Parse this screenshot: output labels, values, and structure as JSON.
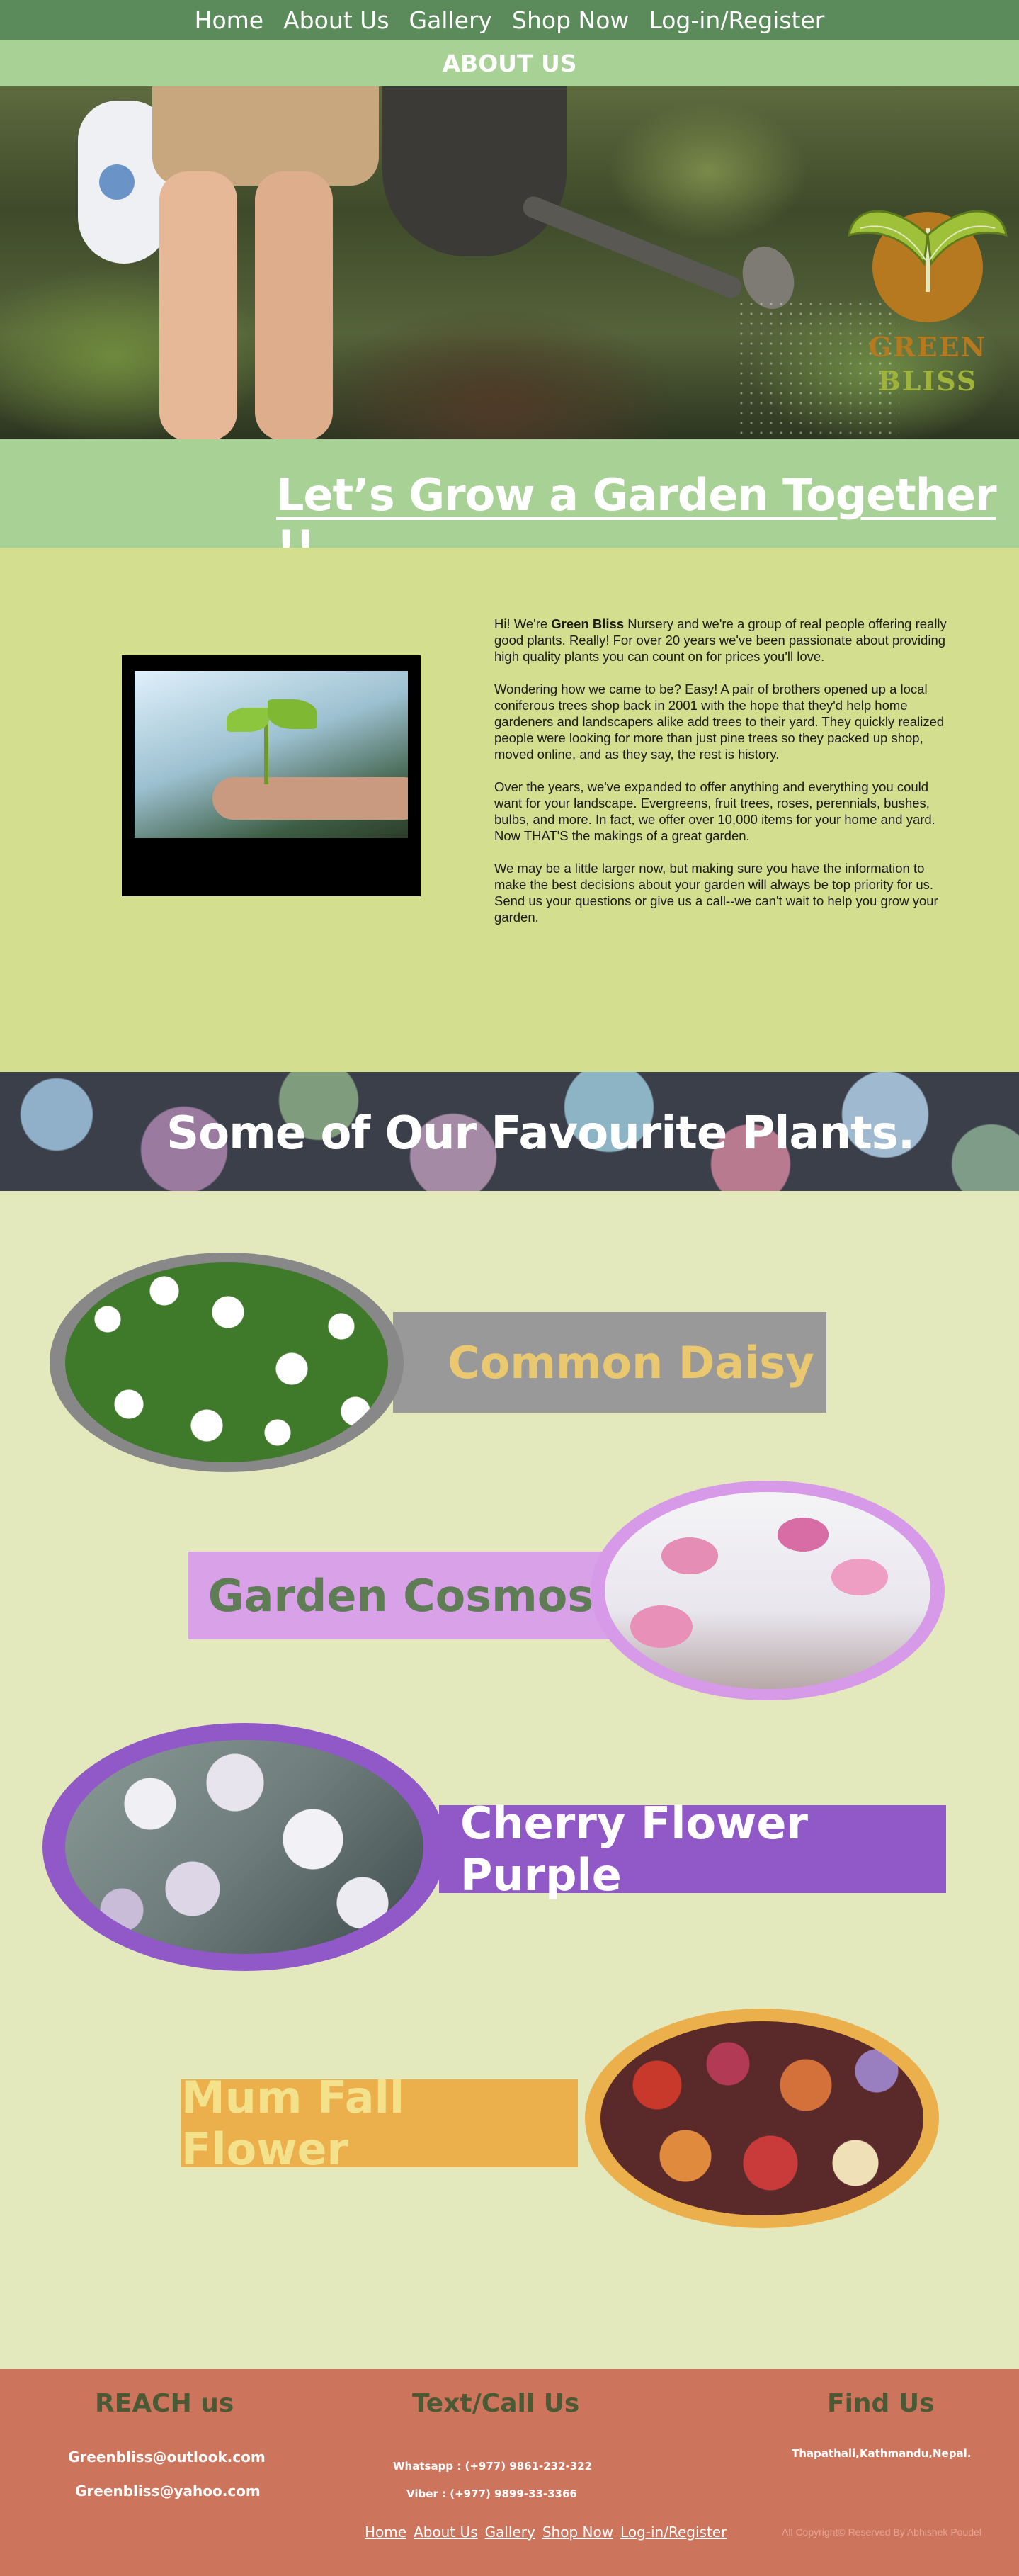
{
  "nav": {
    "items": [
      "Home",
      "About Us",
      "Gallery",
      "Shop Now",
      "Log-in/Register"
    ]
  },
  "subnav": {
    "title": "ABOUT US"
  },
  "logo": {
    "line1": "GREEN",
    "line2": "BLISS"
  },
  "tagline": "Let’s Grow a Garden Together !!",
  "about": {
    "p1_prefix": "Hi! We're ",
    "p1_brand": "Green Bliss",
    "p1_rest": " Nursery and we're a group of real people offering really good plants. Really! For over 20 years we've been passionate about providing high quality plants you can count on for prices you'll love.",
    "p2": "Wondering how we came to be? Easy! A pair of brothers opened up a local coniferous trees shop back in 2001 with the hope that they'd help home gardeners and landscapers alike add trees to their yard. They quickly realized people were looking for more than just pine trees so they packed up shop, moved online, and as they say, the rest is history.",
    "p3": "Over the years, we've expanded to offer anything and everything you could want for your landscape. Evergreens, fruit trees, roses, perennials, bushes, bulbs, and more. In fact, we offer over 10,000 items for your home and yard. Now THAT'S the makings of a great garden.",
    "p4": "We may be a little larger now, but making sure you have the information to make the best decisions about your garden will always be top priority for us. Send us your questions or give us a call--we can't wait to help you grow your garden."
  },
  "favourites": {
    "title": "Some of Our Favourite Plants.",
    "items": [
      {
        "name": "Common Daisy"
      },
      {
        "name": "Garden Cosmos"
      },
      {
        "name": "Cherry Flower Purple"
      },
      {
        "name": "Mum Fall Flower"
      }
    ]
  },
  "footer": {
    "reach_title": "REACH us",
    "text_title": "Text/Call Us",
    "find_title": "Find Us",
    "email1": "Greenbliss@outlook.com",
    "email2": "Greenbliss@yahoo.com",
    "whatsapp": "Whatsapp : (+977) 9861-232-322",
    "viber": "Viber : (+977) 9899-33-3366",
    "address": "Thapathali,Kathmandu,Nepal.",
    "nav": [
      "Home",
      "About Us",
      "Gallery",
      "Shop Now",
      "Log-in/Register"
    ],
    "copyright": "All Copyright© Reserved By Abhishek Poudel"
  },
  "colors": {
    "nav_bg": "#5b8a5b",
    "subnav_bg": "#a8d196",
    "about_bg": "#d4de8f",
    "page_bg": "#e3e9bd",
    "footer_bg": "#cd755c"
  }
}
